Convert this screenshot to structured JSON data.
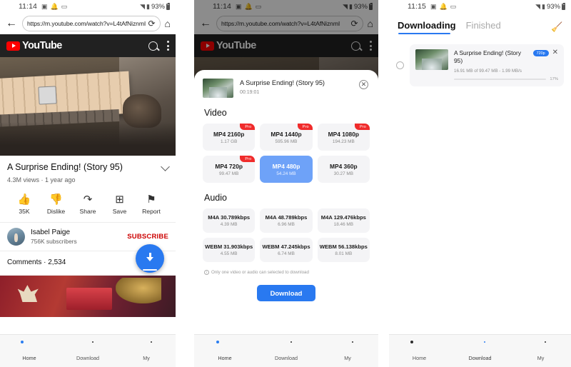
{
  "panel1": {
    "status": {
      "time": "11:14",
      "battery": "93%",
      "icons": [
        "image-icon",
        "bell-icon",
        "message-icon",
        "wifi-icon",
        "signal-icon"
      ]
    },
    "browser": {
      "url": "https://m.youtube.com/watch?v=L4tAfNiznmI",
      "back_label": "back",
      "reload_label": "reload",
      "home_label": "home"
    },
    "youtube": {
      "brand": "YouTube",
      "search_label": "search",
      "menu_label": "more options"
    },
    "video": {
      "title": "A Surprise Ending! (Story 95)",
      "meta": "4.3M views · 1 year ago",
      "actions": [
        {
          "label": "35K",
          "icon": "thumbs-up-icon"
        },
        {
          "label": "Dislike",
          "icon": "thumbs-down-icon"
        },
        {
          "label": "Share",
          "icon": "share-icon"
        },
        {
          "label": "Save",
          "icon": "save-icon"
        },
        {
          "label": "Report",
          "icon": "flag-icon"
        }
      ],
      "channel": {
        "name": "Isabel Paige",
        "subscribers": "756K subscribers",
        "subscribe_label": "SUBSCRIBE"
      },
      "comments": "Comments · 2,534"
    },
    "fab": {
      "label": "download"
    },
    "nav": [
      {
        "label": "Home",
        "icon": "home-icon",
        "active": true
      },
      {
        "label": "Download",
        "icon": "download-icon",
        "active": false
      },
      {
        "label": "My",
        "icon": "profile-icon",
        "active": false
      }
    ]
  },
  "panel2": {
    "status": {
      "time": "11:14",
      "battery": "93%"
    },
    "browser": {
      "url": "https://m.youtube.com/watch?v=L4tAfNiznmI"
    },
    "youtube": {
      "brand": "YouTube"
    },
    "sheet": {
      "title": "A Surprise Ending! (Story 95)",
      "duration": "00:19:01",
      "close_label": "close",
      "video_section": "Video",
      "audio_section": "Audio",
      "video_options": [
        {
          "name": "MP4 2160p",
          "size": "1.17 GB",
          "pro": true,
          "selected": false,
          "pro_label": "Pro"
        },
        {
          "name": "MP4 1440p",
          "size": "595.96 MB",
          "pro": true,
          "selected": false,
          "pro_label": "Pro"
        },
        {
          "name": "MP4 1080p",
          "size": "194.23 MB",
          "pro": true,
          "selected": false,
          "pro_label": "Pro"
        },
        {
          "name": "MP4 720p",
          "size": "99.47 MB",
          "pro": true,
          "selected": false,
          "pro_label": "Pro"
        },
        {
          "name": "MP4 480p",
          "size": "54.24 MB",
          "pro": false,
          "selected": true,
          "pro_label": ""
        },
        {
          "name": "MP4 360p",
          "size": "30.27 MB",
          "pro": false,
          "selected": false,
          "pro_label": ""
        }
      ],
      "audio_options": [
        {
          "name": "M4A 30.789kbps",
          "size": "4.39 MB",
          "selected": false
        },
        {
          "name": "M4A 48.789kbps",
          "size": "6.96 MB",
          "selected": false
        },
        {
          "name": "M4A 129.476kbps",
          "size": "18.46 MB",
          "selected": false
        },
        {
          "name": "WEBM 31.903kbps",
          "size": "4.55 MB",
          "selected": false
        },
        {
          "name": "WEBM 47.245kbps",
          "size": "6.74 MB",
          "selected": false
        },
        {
          "name": "WEBM 56.138kbps",
          "size": "8.01 MB",
          "selected": false
        }
      ],
      "note": "Only one video or audio can selected to download",
      "download_button": "Download"
    },
    "nav": [
      {
        "label": "Home",
        "active": true
      },
      {
        "label": "Download",
        "active": false
      },
      {
        "label": "My",
        "active": false
      }
    ]
  },
  "panel3": {
    "status": {
      "time": "11:15",
      "battery": "93%"
    },
    "tabs": [
      {
        "label": "Downloading",
        "active": true
      },
      {
        "label": "Finished",
        "active": false
      }
    ],
    "clear_label": "clear",
    "item": {
      "title": "A Surprise Ending! (Story 95)",
      "quality": "720p",
      "stats": "16.91 MB of 99.47 MB - 1.99 MB/s",
      "percent": "17%",
      "progress": 17,
      "close_label": "cancel"
    },
    "nav": [
      {
        "label": "Home",
        "active": false
      },
      {
        "label": "Download",
        "active": true
      },
      {
        "label": "My",
        "active": false
      }
    ]
  },
  "colors": {
    "accent": "#2979f0",
    "youtube_red": "#ff0000",
    "pro_red": "#f02b2b",
    "selected_blue": "#6ea2f8"
  }
}
